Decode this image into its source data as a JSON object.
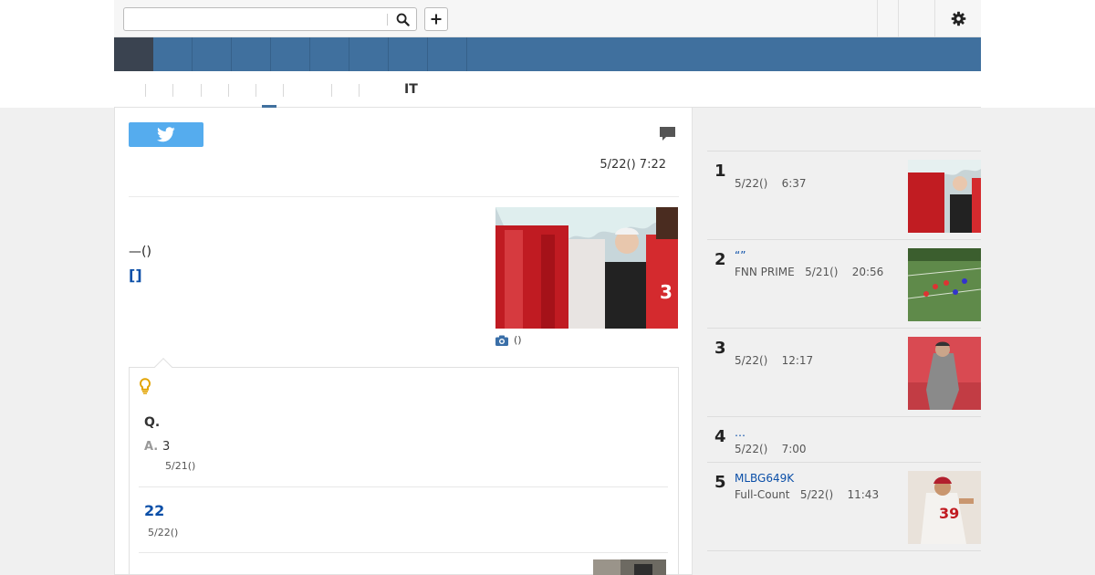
{
  "search": {
    "placeholder": ""
  },
  "subnav": {
    "active_label": "IT"
  },
  "article": {
    "date": "5/22() 7:22",
    "text": "—()",
    "link": "[]",
    "photo_caption": "()",
    "colors": {
      "accent": "#40709e",
      "link": "#0b4fa8",
      "twitter": "#55acee"
    }
  },
  "qa": {
    "question": "Q.",
    "answer_label": "A.",
    "answer_text": "3",
    "answer_date": "5/21()",
    "number": "22",
    "number_date": "5/22()"
  },
  "ranking": {
    "items": [
      {
        "rank": "1",
        "title": "",
        "meta": "5/22()    6:37"
      },
      {
        "rank": "2",
        "title": "“”",
        "meta": "FNN PRIME   5/21()    20:56"
      },
      {
        "rank": "3",
        "title": "",
        "meta": "5/22()    12:17"
      },
      {
        "rank": "4",
        "title": "…",
        "meta": "5/22()    7:00"
      },
      {
        "rank": "5",
        "title": "MLBG649K",
        "meta": "Full-Count   5/22()    11:43"
      }
    ]
  }
}
